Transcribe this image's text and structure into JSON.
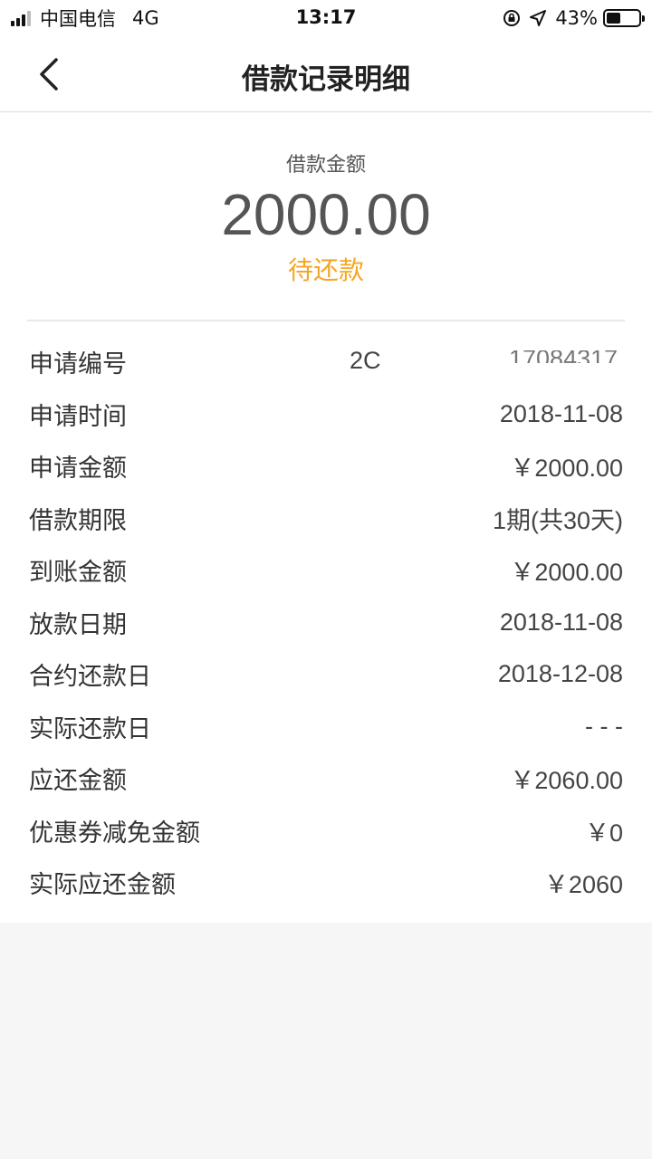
{
  "status_bar": {
    "carrier": "中国电信",
    "network": "4G",
    "time": "13:17",
    "battery_percent": "43%",
    "battery_level": 0.43
  },
  "nav": {
    "title": "借款记录明细"
  },
  "summary": {
    "label": "借款金额",
    "amount": "2000.00",
    "status": "待还款",
    "status_color": "#f5a623"
  },
  "details": [
    {
      "label": "申请编号",
      "value": "2C",
      "masked_tail": "17084317"
    },
    {
      "label": "申请时间",
      "value": "2018-11-08"
    },
    {
      "label": "申请金额",
      "value": "￥2000.00"
    },
    {
      "label": "借款期限",
      "value": "1期(共30天)"
    },
    {
      "label": "到账金额",
      "value": "￥2000.00"
    },
    {
      "label": "放款日期",
      "value": "2018-11-08"
    },
    {
      "label": "合约还款日",
      "value": "2018-12-08"
    },
    {
      "label": "实际还款日",
      "value": "- - -"
    },
    {
      "label": "应还金额",
      "value": "￥2060.00"
    },
    {
      "label": "优惠券减免金额",
      "value": "￥0"
    },
    {
      "label": "实际应还金额",
      "value": "￥2060"
    }
  ]
}
